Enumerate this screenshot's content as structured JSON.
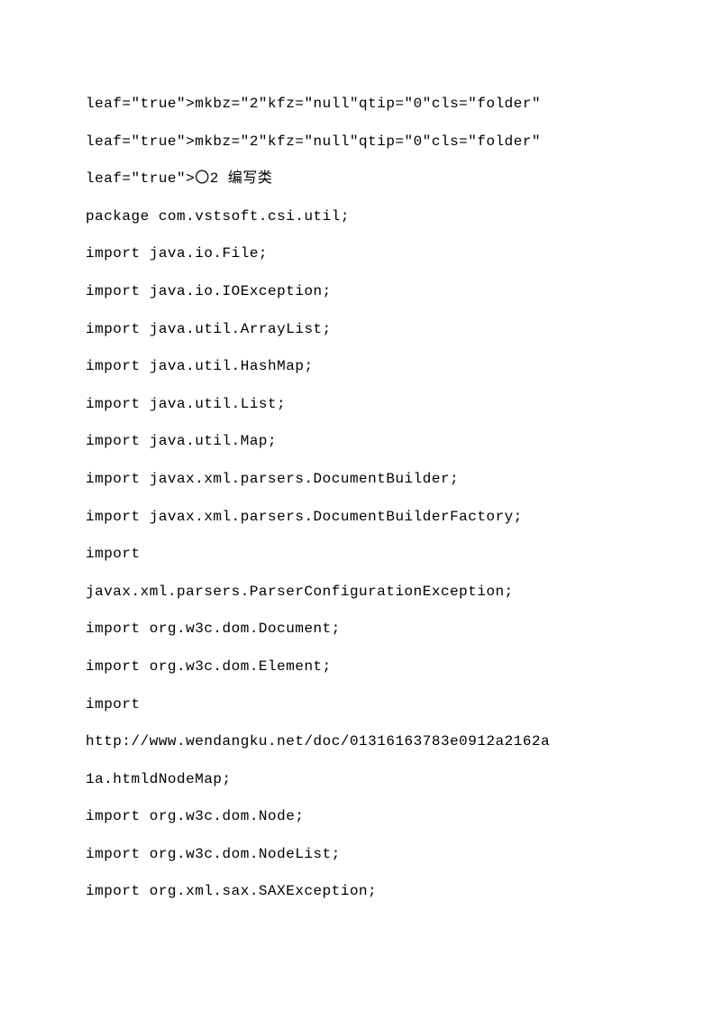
{
  "lines": [
    "leaf=\"true\">mkbz=\"2\"kfz=\"null\"qtip=\"0\"cls=\"folder\"",
    "leaf=\"true\">mkbz=\"2\"kfz=\"null\"qtip=\"0\"cls=\"folder\"",
    "leaf=\"true\">〇2 编写类",
    "package com.vstsoft.csi.util;",
    "import java.io.File;",
    "import java.io.IOException;",
    "import java.util.ArrayList;",
    "import java.util.HashMap;",
    "import java.util.List;",
    "import java.util.Map;",
    "import javax.xml.parsers.DocumentBuilder;",
    "import javax.xml.parsers.DocumentBuilderFactory;",
    "import",
    "javax.xml.parsers.ParserConfigurationException;",
    "import org.w3c.dom.Document;",
    "import org.w3c.dom.Element;",
    "import",
    "http://www.wendangku.net/doc/01316163783e0912a2162a",
    "1a.htmldNodeMap;",
    "import org.w3c.dom.Node;",
    "import org.w3c.dom.NodeList;",
    "import org.xml.sax.SAXException;"
  ]
}
